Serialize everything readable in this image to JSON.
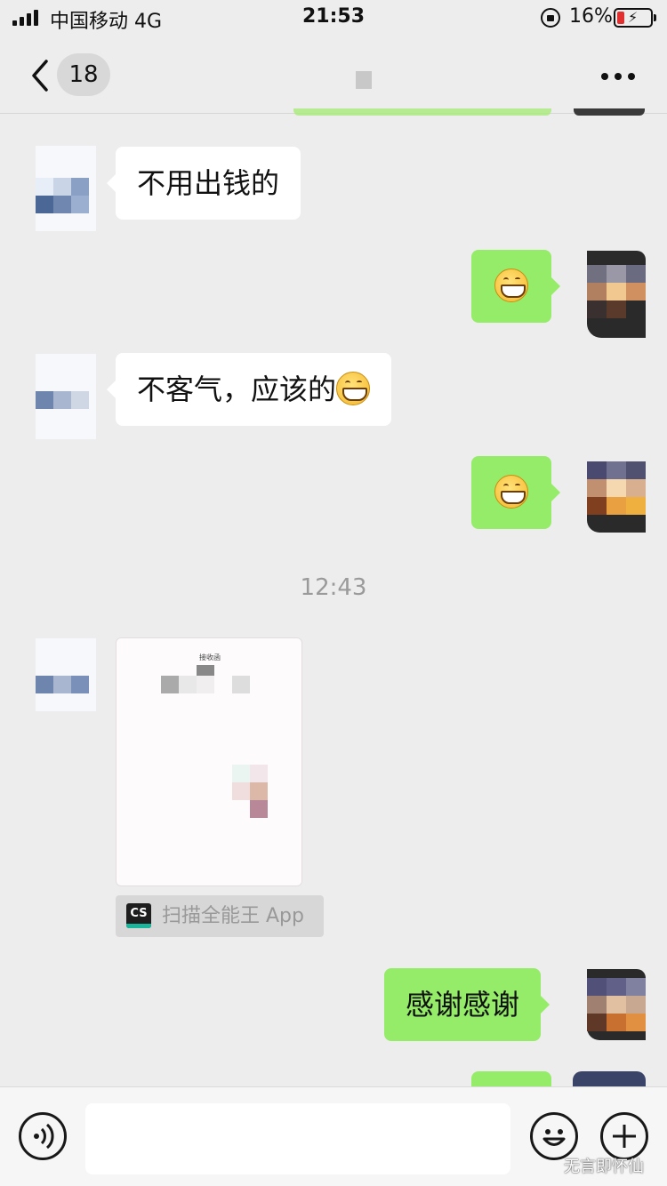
{
  "status_bar": {
    "carrier": "中国移动  4G",
    "time": "21:53",
    "battery_percent": "16%"
  },
  "nav": {
    "unread_count": "18"
  },
  "messages": [
    {
      "side": "in",
      "text": "不用出钱的"
    },
    {
      "side": "out",
      "emoji": "grinning-face"
    },
    {
      "side": "in",
      "text": "不客气，应该的",
      "emoji": "grinning-face"
    },
    {
      "side": "out",
      "emoji": "grinning-face"
    },
    {
      "timestamp": "12:43"
    },
    {
      "side": "in",
      "document": {
        "title": "接收函",
        "app_label": "扫描全能王 App",
        "app_logo": "CS"
      }
    },
    {
      "side": "out",
      "text": "感谢感谢"
    }
  ],
  "input": {
    "left_icon": "voice-icon",
    "right_icons": [
      "emoji-icon",
      "plus-icon"
    ]
  },
  "watermark": "无言即怀仙",
  "colors": {
    "background": "#ededed",
    "outgoing_bubble": "#95ec69",
    "incoming_bubble": "#ffffff",
    "battery_low": "#e03030"
  }
}
